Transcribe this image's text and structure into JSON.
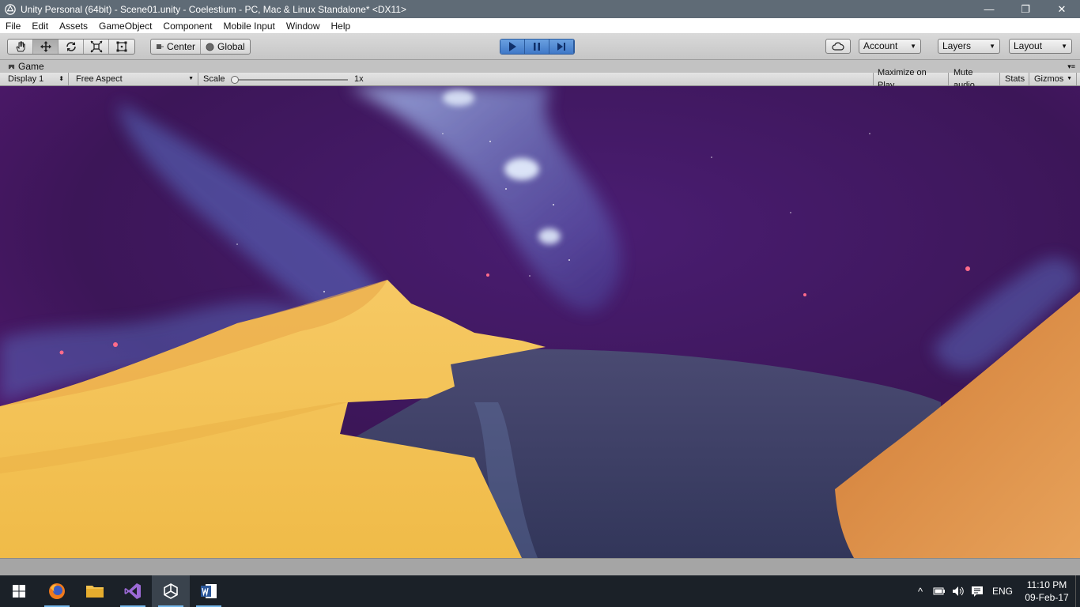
{
  "window": {
    "title": "Unity Personal (64bit) - Scene01.unity - Coelestium - PC, Mac & Linux Standalone* <DX11>",
    "minimize": "—",
    "maximize": "❐",
    "close": "✕"
  },
  "menu": [
    "File",
    "Edit",
    "Assets",
    "GameObject",
    "Component",
    "Mobile Input",
    "Window",
    "Help"
  ],
  "toolbar": {
    "tools": [
      "hand-icon",
      "move-icon",
      "rotate-icon",
      "scale-icon",
      "rect-transform-icon"
    ],
    "active_tool": "move-icon",
    "pivot": "Center",
    "space": "Global",
    "account": "Account",
    "layers": "Layers",
    "layout": "Layout"
  },
  "game_tab": {
    "label": "Game"
  },
  "game_bar": {
    "display": "Display 1",
    "aspect": "Free Aspect",
    "scale_label": "Scale",
    "scale_value": "1x",
    "scale_fraction": 0.0,
    "maximize": "Maximize on Play",
    "mute": "Mute audio",
    "stats": "Stats",
    "gizmos": "Gizmos"
  },
  "taskbar": {
    "apps": [
      "firefox-icon",
      "file-explorer-icon",
      "visual-studio-icon",
      "unity-icon",
      "word-icon"
    ],
    "active_app": "unity-icon",
    "language": "ENG",
    "time": "11:10 PM",
    "date": "09-Feb-17"
  },
  "colors": {
    "sky": "#3c1658",
    "nebula": "#7fa8ff",
    "sand_light": "#f3c45a",
    "sand_dark": "#d9883f",
    "water": "#3f3f66",
    "play_blue": "#3f78c8"
  }
}
